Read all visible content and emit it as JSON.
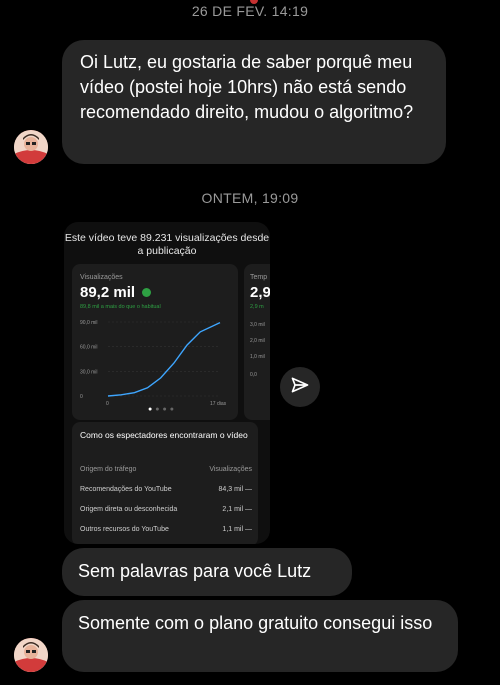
{
  "timestamps": {
    "first": "26 DE FEV. 14:19",
    "second": "ONTEM, 19:09"
  },
  "messages": {
    "question": "Oi Lutz, eu gostaria de saber porquê meu vídeo (postei hoje 10hrs) não está sendo recomendado direito, mudou o algoritmo?",
    "no_words": "Sem palavras para você Lutz",
    "free_plan": "Somente com o plano gratuito consegui isso"
  },
  "shared_screenshot": {
    "title": "Este vídeo teve 89.231 visualizações desde a publicação",
    "views_card": {
      "label": "Visualizações",
      "value": "89,2 mil",
      "delta_text": "89,8 mil a mais do que o habitual",
      "y_ticks": [
        "90,0 mil",
        "60,0 mil",
        "30,0 mil",
        "0"
      ],
      "x_start": "0",
      "x_end": "17 dias"
    },
    "side_card": {
      "label": "Temp",
      "value": "2,9",
      "delta_text": "2,9 m",
      "y_ticks": [
        "3,0 mil",
        "2,0 mil",
        "1,0 mil",
        "0,0"
      ]
    },
    "traffic": {
      "heading": "Como os espectadores encontraram o vídeo",
      "col_source": "Origem do tráfego",
      "col_views": "Visualizações",
      "rows": [
        {
          "source": "Recomendações do YouTube",
          "views": "84,3 mil",
          "dash": "—"
        },
        {
          "source": "Origem direta ou desconhecida",
          "views": "2,1 mil",
          "dash": "—"
        },
        {
          "source": "Outros recursos do YouTube",
          "views": "1,1 mil",
          "dash": "—"
        }
      ]
    },
    "chart_data": {
      "type": "line",
      "x": [
        0,
        2,
        4,
        6,
        8,
        10,
        12,
        14,
        17
      ],
      "values": [
        0,
        1500,
        4000,
        10000,
        22000,
        40000,
        62000,
        78000,
        89231
      ],
      "ylim": [
        0,
        90000
      ],
      "xlim": [
        0,
        17
      ],
      "xlabel": "",
      "ylabel": "",
      "color": "#3ea6ff"
    }
  },
  "icons": {
    "share": "paper-plane-icon",
    "avatar": "avatar"
  }
}
